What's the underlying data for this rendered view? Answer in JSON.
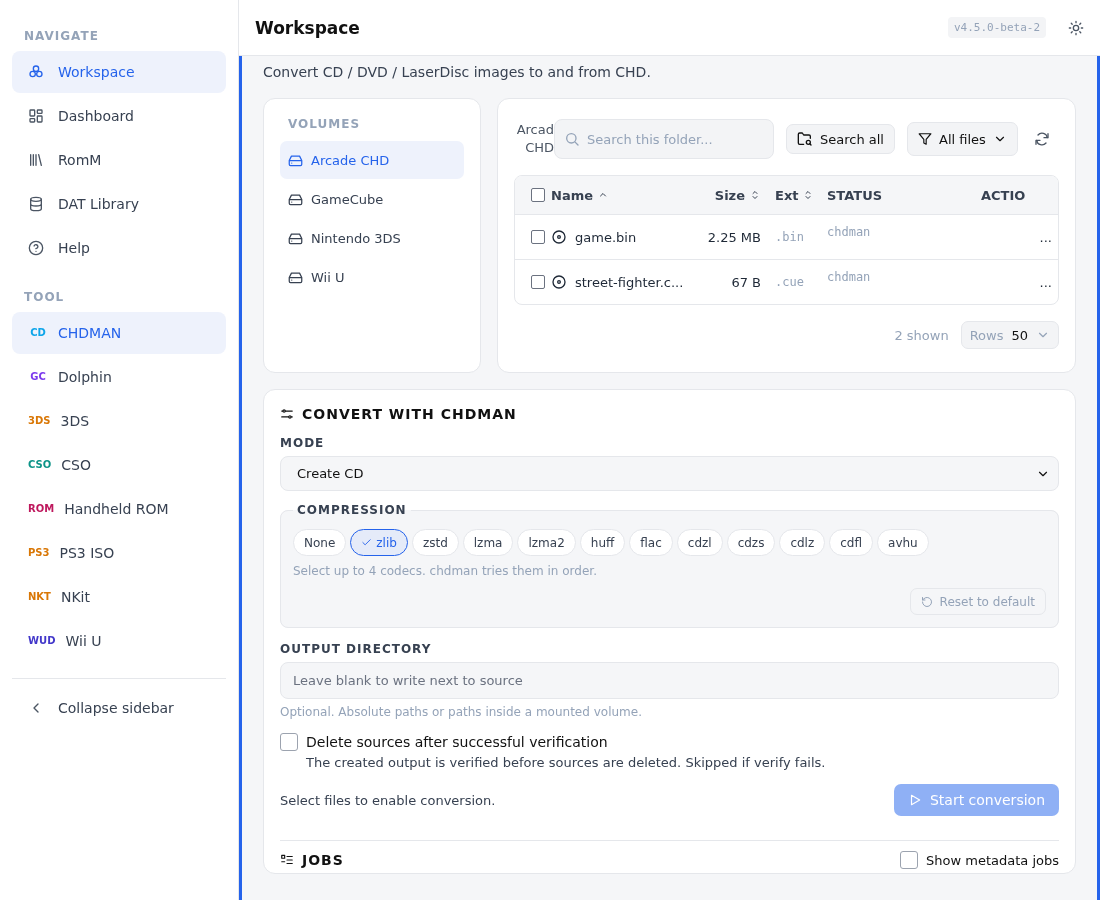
{
  "sidebar": {
    "sections": [
      {
        "title": "NAVIGATE",
        "items": [
          {
            "label": "Workspace",
            "selected": true
          },
          {
            "label": "Dashboard",
            "selected": false
          },
          {
            "label": "RomM",
            "selected": false
          },
          {
            "label": "DAT Library",
            "selected": false
          },
          {
            "label": "Help",
            "selected": false
          }
        ]
      },
      {
        "title": "TOOL",
        "items": [
          {
            "label": "CHDMAN",
            "badge": "CD",
            "color": "#0ea5e9",
            "selected": true
          },
          {
            "label": "Dolphin",
            "badge": "GC",
            "color": "#7c3aed",
            "selected": false
          },
          {
            "label": "3DS",
            "badge": "3DS",
            "color": "#d97706",
            "selected": false
          },
          {
            "label": "CSO",
            "badge": "CSO",
            "color": "#0d9488",
            "selected": false
          },
          {
            "label": "Handheld ROM",
            "badge": "ROM",
            "color": "#be185d",
            "selected": false
          },
          {
            "label": "PS3 ISO",
            "badge": "PS3",
            "color": "#d97706",
            "selected": false
          },
          {
            "label": "NKit",
            "badge": "NKT",
            "color": "#d97706",
            "selected": false
          },
          {
            "label": "Wii U",
            "badge": "WUD",
            "color": "#4338ca",
            "selected": false
          }
        ]
      }
    ],
    "collapse": "Collapse sidebar"
  },
  "header": {
    "title": "Workspace",
    "version": "v4.5.0-beta-2"
  },
  "subtitle": "Convert CD / DVD / LaserDisc images to and from CHD.",
  "volumes": {
    "title": "VOLUMES",
    "items": [
      {
        "label": "Arcade CHD",
        "selected": true
      },
      {
        "label": "GameCube",
        "selected": false
      },
      {
        "label": "Nintendo 3DS",
        "selected": false
      },
      {
        "label": "Wii U",
        "selected": false
      }
    ]
  },
  "browser": {
    "folder": "Arcad CHD",
    "search": {
      "placeholder": "Search this folder..."
    },
    "search_all": "Search all",
    "filter": "All files",
    "table": {
      "all_checked": false,
      "columns": [
        "Name",
        "Size",
        "Ext",
        "STATUS",
        "ACTIO"
      ],
      "rows": [
        {
          "checked": false,
          "name": "game.bin",
          "size": "2.25 MB",
          "ext": ".bin",
          "status": "chdman",
          "action": "..."
        },
        {
          "checked": false,
          "name": "street-fighter.c...",
          "size": "67 B",
          "ext": ".cue",
          "status": "chdman",
          "action": "..."
        }
      ]
    },
    "shown": "2 shown",
    "rows_label": "Rows",
    "rows_value": "50"
  },
  "convert": {
    "title": "CONVERT WITH CHDMAN",
    "mode_label": "MODE",
    "mode": "Create CD",
    "compression_label": "COMPRESSION",
    "codecs": [
      {
        "label": "None",
        "selected": false
      },
      {
        "label": "zlib",
        "selected": true
      },
      {
        "label": "zstd",
        "selected": false
      },
      {
        "label": "lzma",
        "selected": false
      },
      {
        "label": "lzma2",
        "selected": false
      },
      {
        "label": "huff",
        "selected": false
      },
      {
        "label": "flac",
        "selected": false
      },
      {
        "label": "cdzl",
        "selected": false
      },
      {
        "label": "cdzs",
        "selected": false
      },
      {
        "label": "cdlz",
        "selected": false
      },
      {
        "label": "cdfl",
        "selected": false
      },
      {
        "label": "avhu",
        "selected": false
      }
    ],
    "codec_hint": "Select up to 4 codecs. chdman tries them in order.",
    "reset": "Reset to default",
    "output_label": "OUTPUT DIRECTORY",
    "output": {
      "placeholder": "Leave blank to write next to source"
    },
    "output_hint": "Optional. Absolute paths or paths inside a mounted volume.",
    "delete": {
      "label": "Delete sources after successful verification",
      "checked": false,
      "hint": "The created output is verified before sources are deleted. Skipped if verify fails."
    },
    "status": "Select files to enable conversion.",
    "start": "Start conversion",
    "start_disabled": true
  },
  "jobs": {
    "title": "JOBS",
    "metadata": {
      "label": "Show metadata jobs",
      "checked": false
    }
  }
}
